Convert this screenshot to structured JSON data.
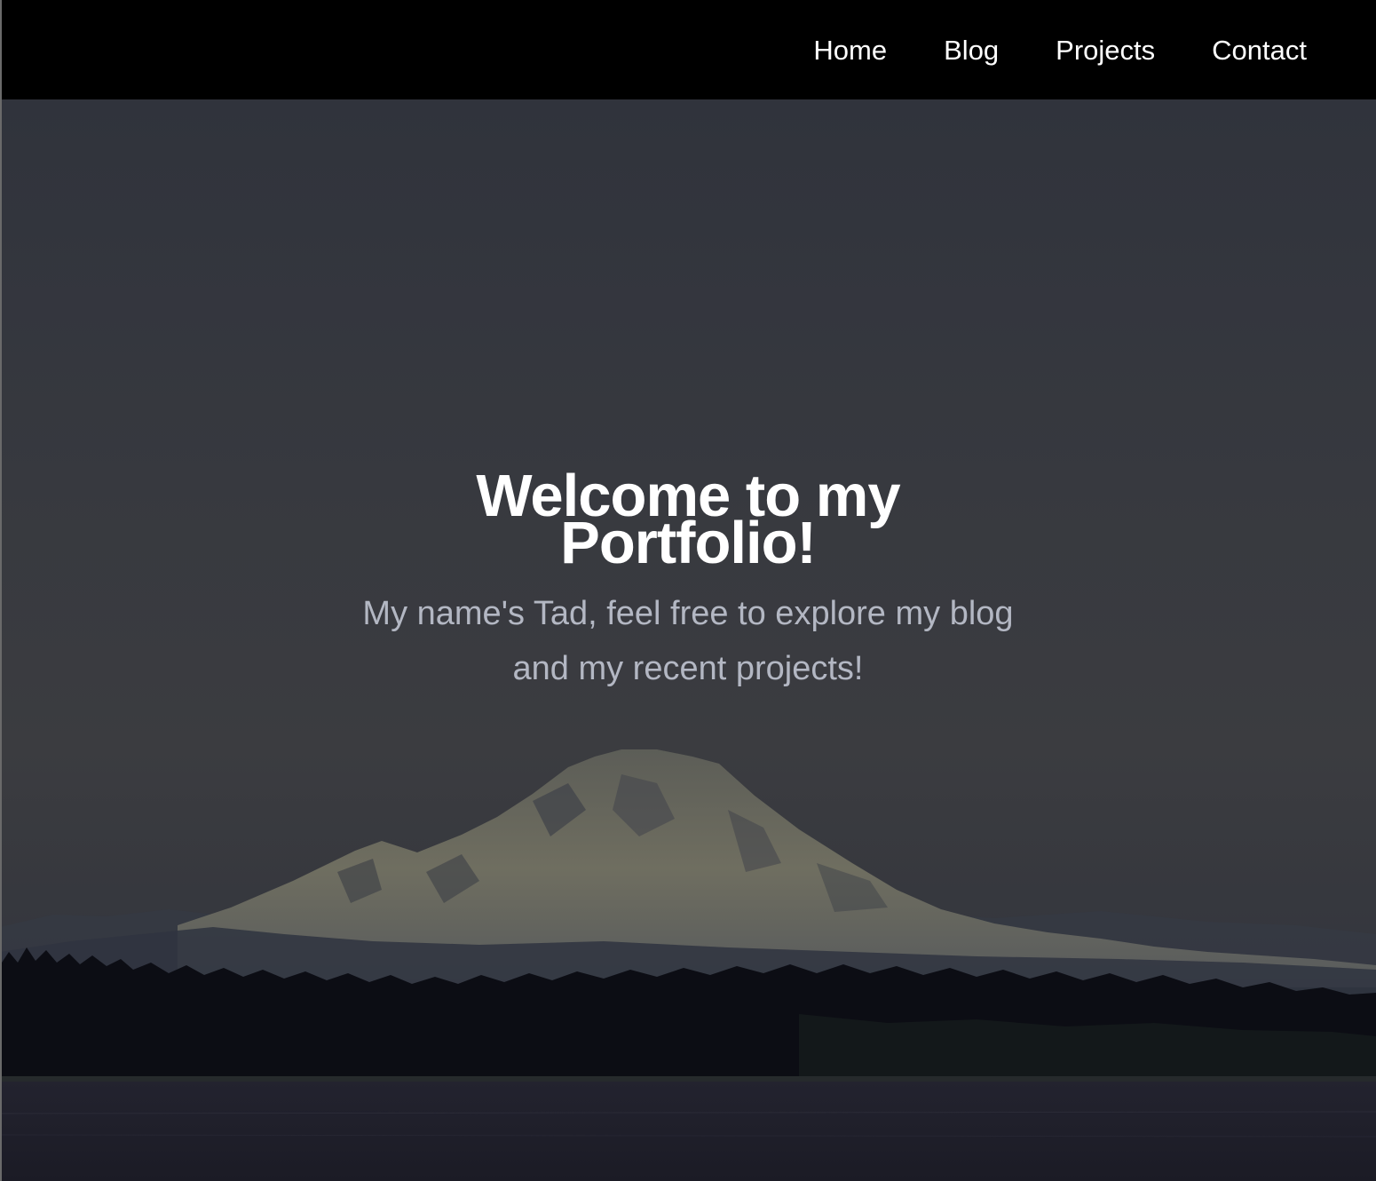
{
  "nav": {
    "links": [
      {
        "label": "Home"
      },
      {
        "label": "Blog"
      },
      {
        "label": "Projects"
      },
      {
        "label": "Contact"
      }
    ]
  },
  "hero": {
    "title": "Welcome to my Portfolio!",
    "subtitle": "My name's Tad, feel free to explore my blog and my recent projects!",
    "background_image": "snow-capped-mountain-over-forest-and-lake-icon"
  },
  "colors": {
    "nav_background": "#000000",
    "nav_text": "#ffffff",
    "hero_title": "#ffffff",
    "hero_subtitle": "#b3b7c3",
    "hero_overlay": "#33363d"
  }
}
